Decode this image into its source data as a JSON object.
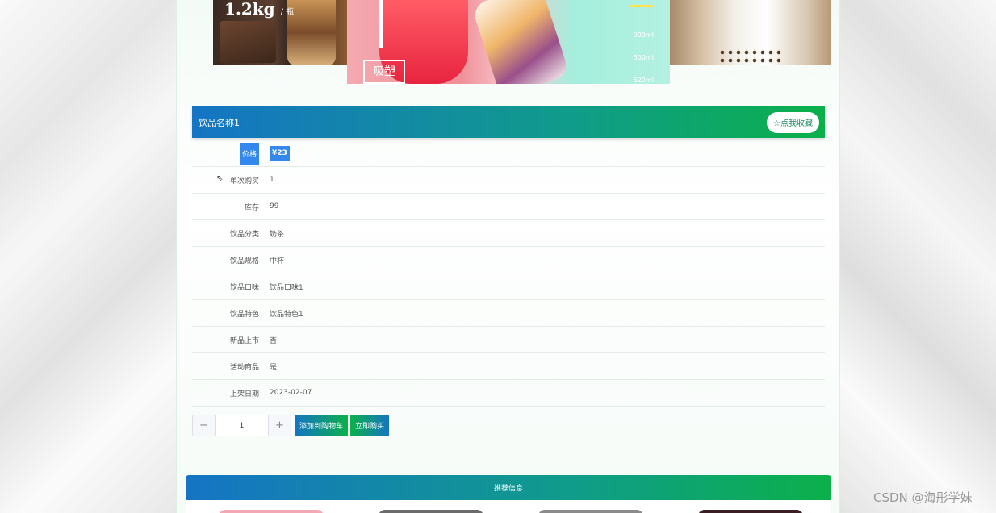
{
  "banner": {
    "weight": "1.2kg",
    "weight_unit": "/ 瓶",
    "sizes": [
      "900ml",
      "500ml",
      "520ml"
    ],
    "logo_text": "吸塑"
  },
  "product": {
    "name": "饮品名称1",
    "favorite_label": "☆点我收藏"
  },
  "details": [
    {
      "label": "价格",
      "value": "¥23"
    },
    {
      "label": "单次购买",
      "value": "1"
    },
    {
      "label": "库存",
      "value": "99"
    },
    {
      "label": "饮品分类",
      "value": "奶茶"
    },
    {
      "label": "饮品规格",
      "value": "中杯"
    },
    {
      "label": "饮品口味",
      "value": "饮品口味1"
    },
    {
      "label": "饮品特色",
      "value": "饮品特色1"
    },
    {
      "label": "新品上市",
      "value": "否"
    },
    {
      "label": "活动商品",
      "value": "是"
    },
    {
      "label": "上架日期",
      "value": "2023-02-07"
    }
  ],
  "purchase": {
    "minus": "−",
    "quantity": "1",
    "plus": "+",
    "add_to_cart": "添加到购物车",
    "buy_now": "立即购买"
  },
  "recommend": {
    "title": "推荐信息"
  },
  "watermark": "CSDN @海彤学妹",
  "colors": {
    "accent_blue": "#1574c4",
    "accent_green": "#0bb04a",
    "highlight": "#3388ee"
  }
}
